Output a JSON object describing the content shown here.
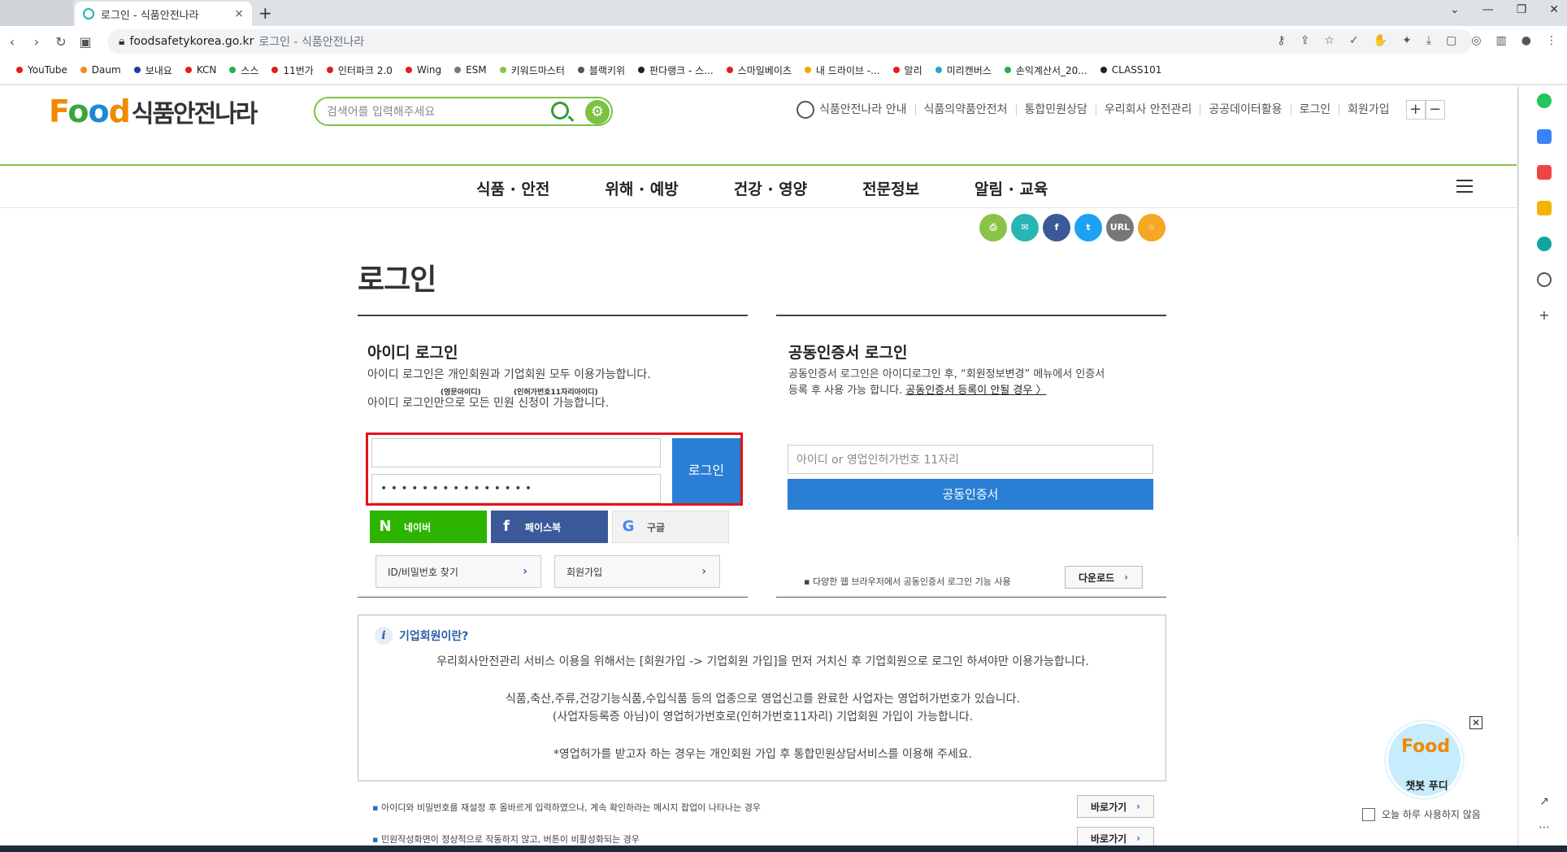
{
  "browser": {
    "tab_title": "로그인 - 식품안전나라",
    "tab_close": "×",
    "new_tab": "+",
    "window_controls": [
      "⌄",
      "—",
      "❐",
      "✕"
    ],
    "address_domain": "foodsafetykorea.go.kr",
    "address_rest": "로그인 - 식품안전나라",
    "bookmarks": [
      {
        "label": "YouTube",
        "color": "#e01e1e"
      },
      {
        "label": "Daum",
        "color": "#f08a24"
      },
      {
        "label": "보내요",
        "color": "#1a3fa0"
      },
      {
        "label": "KCN",
        "color": "#e01e1e"
      },
      {
        "label": "스스",
        "color": "#22b04b"
      },
      {
        "label": "11번가",
        "color": "#e01e1e"
      },
      {
        "label": "인터파크 2.0",
        "color": "#e01e1e"
      },
      {
        "label": "Wing",
        "color": "#e01e1e"
      },
      {
        "label": "ESM",
        "color": "#777777"
      },
      {
        "label": "키워드마스터",
        "color": "#8bc34a"
      },
      {
        "label": "블랙키위",
        "color": "#555555"
      },
      {
        "label": "판다랭크 - 스...",
        "color": "#222222"
      },
      {
        "label": "스마일베이츠",
        "color": "#e01e1e"
      },
      {
        "label": "내 드라이브 -...",
        "color": "#f0a800"
      },
      {
        "label": "알리",
        "color": "#e01e1e"
      },
      {
        "label": "미리캔버스",
        "color": "#1fa8c9"
      },
      {
        "label": "손익계산서_20...",
        "color": "#22b04b"
      },
      {
        "label": "CLASS101",
        "color": "#222222"
      }
    ]
  },
  "header": {
    "logo_food": [
      "F",
      "o",
      "o",
      "d"
    ],
    "logo_name": "식품안전나라",
    "search_placeholder": "검색어를 입력해주세요",
    "util_nav": [
      "식품안전나라 안내",
      "식품의약품안전처",
      "통합민원상담",
      "우리회사 안전관리",
      "공공데이터활용",
      "로그인",
      "회원가입"
    ],
    "zoom_in": "+",
    "zoom_out": "−"
  },
  "main_nav": [
    "식품 · 안전",
    "위해 · 예방",
    "건강 · 영양",
    "전문정보",
    "알림 · 교육"
  ],
  "share": [
    {
      "icon": "print-icon",
      "label": "⎙",
      "color": "#8bc34a"
    },
    {
      "icon": "mail-icon",
      "label": "✉",
      "color": "#28b5b5"
    },
    {
      "icon": "facebook-icon",
      "label": "f",
      "color": "#3b5998"
    },
    {
      "icon": "twitter-icon",
      "label": "t",
      "color": "#1da1f2"
    },
    {
      "icon": "url-icon",
      "label": "URL",
      "color": "#777777"
    },
    {
      "icon": "favorite-icon",
      "label": "☆",
      "color": "#f5a623"
    }
  ],
  "page_title": "로그인",
  "id_login": {
    "heading": "아이디 로그인",
    "desc1": "아이디 로그인은 개인회원과 기업회원 모두 이용가능합니다.",
    "note_a": "(영문아이디)",
    "note_b": "(인허가번호11자리아이디)",
    "desc2": "아이디 로그인만으로 모든 민원 신청이 가능합니다.",
    "id_value": "",
    "pw_value": "• • • • • • • • • • • • • • •",
    "login_button": "로그인",
    "naver": "네이버",
    "facebook": "페이스북",
    "google": "구글",
    "find_button": "ID/비밀번호 찾기",
    "signup_button": "회원가입",
    "chevron": "›"
  },
  "cert_login": {
    "heading": "공동인증서 로그인",
    "desc1": "공동인증서 로그인은 아이디로그인 후, “회원정보변경” 메뉴에서 인증서",
    "desc2": "등록 후 사용 가능 합니다.",
    "desc_link": "공동인증서 등록이 안될 경우 〉",
    "input_placeholder": "아이디 or 영업인허가번호 11자리",
    "cert_button": "공동인증서",
    "note": "다양한 웹 브라우저에서 공동인증서 로그인 기능 사용",
    "download_button": "다운로드"
  },
  "info": {
    "title": "기업회원이란?",
    "line1": "우리회사안전관리 서비스 이용을 위해서는 [회원가입 -> 기업회원 가입]을 먼저 거치신 후 기업회원으로 로그인 하셔야만 이용가능합니다.",
    "line2": "식품,축산,주류,건강기능식품,수입식품 등의 업종으로 영업신고를 완료한 사업자는 영업허가번호가 있습니다.",
    "line3": "(사업자등록증 아님)이 영업허가번호로(인허가번호11자리) 기업회원 가입이 가능합니다.",
    "line4": "*영업허가를 받고자 하는 경우는 개인회원 가입 후 통합민원상담서비스를 이용해 주세요."
  },
  "help_rows": [
    {
      "text": "아이디와 비밀번호를 재설정 후 올바르게 입력하였으나, 계속 확인하라는 메시지 팝업이 나타나는 경우",
      "button": "바로가기"
    },
    {
      "text": "민원작성화면이 정상적으로 작동하지 않고, 버튼이 비활성화되는 경우",
      "button": "바로가기"
    }
  ],
  "chatbot": {
    "logo": "Food",
    "label": "챗봇 푸디",
    "close": "✕",
    "no_today": "오늘 하루 사용하지 않음"
  }
}
